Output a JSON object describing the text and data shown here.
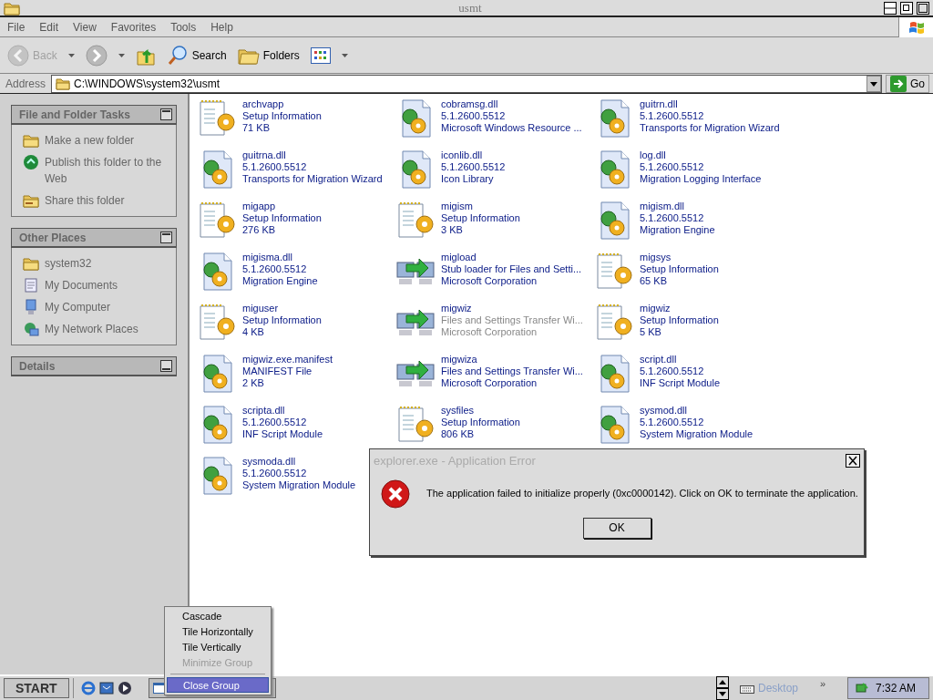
{
  "window": {
    "title": "usmt"
  },
  "menu": [
    "File",
    "Edit",
    "View",
    "Favorites",
    "Tools",
    "Help"
  ],
  "toolbar": [
    {
      "kind": "back",
      "label": "Back",
      "disabled": true
    },
    {
      "kind": "forward",
      "disabled": false
    },
    {
      "kind": "up",
      "disabled": false
    },
    {
      "kind": "search",
      "label": "Search",
      "disabled": false
    },
    {
      "kind": "folders",
      "label": "Folders",
      "disabled": false
    },
    {
      "kind": "views",
      "disabled": false
    }
  ],
  "address": {
    "label": "Address",
    "value": "C:\\WINDOWS\\system32\\usmt",
    "go": "Go"
  },
  "sidebar": [
    {
      "title": "File and Folder Tasks",
      "expanded": true,
      "items": [
        {
          "kind": "newfolder",
          "label": "Make a new folder"
        },
        {
          "kind": "web",
          "label": "Publish this folder to the Web"
        },
        {
          "kind": "share",
          "label": "Share this folder"
        }
      ]
    },
    {
      "title": "Other Places",
      "expanded": true,
      "items": [
        {
          "kind": "folder",
          "label": "system32"
        },
        {
          "kind": "docs",
          "label": "My Documents"
        },
        {
          "kind": "computer",
          "label": "My Computer"
        },
        {
          "kind": "network",
          "label": "My Network Places"
        }
      ]
    },
    {
      "title": "Details",
      "expanded": false
    }
  ],
  "files": [
    {
      "kind": "setup",
      "name": "archvapp",
      "line1": "Setup Information",
      "line2": "71 KB",
      "dimmed": false
    },
    {
      "kind": "dll",
      "name": "cobramsg.dll",
      "line1": "5.1.2600.5512",
      "line2": "Microsoft Windows Resource ...",
      "dimmed": false
    },
    {
      "kind": "dll",
      "name": "guitrn.dll",
      "line1": "5.1.2600.5512",
      "line2": "Transports for Migration Wizard",
      "dimmed": false
    },
    {
      "kind": "dll",
      "name": "guitrna.dll",
      "line1": "5.1.2600.5512",
      "line2": "Transports for Migration Wizard",
      "dimmed": false
    },
    {
      "kind": "dll",
      "name": "iconlib.dll",
      "line1": "5.1.2600.5512",
      "line2": "Icon Library",
      "dimmed": false
    },
    {
      "kind": "dll",
      "name": "log.dll",
      "line1": "5.1.2600.5512",
      "line2": "Migration Logging Interface",
      "dimmed": false
    },
    {
      "kind": "setup",
      "name": "migapp",
      "line1": "Setup Information",
      "line2": "276 KB",
      "dimmed": false
    },
    {
      "kind": "setup",
      "name": "migism",
      "line1": "Setup Information",
      "line2": "3 KB",
      "dimmed": false
    },
    {
      "kind": "dll",
      "name": "migism.dll",
      "line1": "5.1.2600.5512",
      "line2": "Migration Engine",
      "dimmed": false
    },
    {
      "kind": "dll",
      "name": "migisma.dll",
      "line1": "5.1.2600.5512",
      "line2": "Migration Engine",
      "dimmed": false
    },
    {
      "kind": "exe",
      "name": "migload",
      "line1": "Stub loader for Files and Setti...",
      "line2": "Microsoft Corporation",
      "dimmed": false
    },
    {
      "kind": "setup",
      "name": "migsys",
      "line1": "Setup Information",
      "line2": "65 KB",
      "dimmed": false
    },
    {
      "kind": "setup",
      "name": "miguser",
      "line1": "Setup Information",
      "line2": "4 KB",
      "dimmed": false
    },
    {
      "kind": "exe",
      "name": "migwiz",
      "line1": "Files and Settings Transfer Wi...",
      "line2": "Microsoft Corporation",
      "dimmed": true
    },
    {
      "kind": "setup",
      "name": "migwiz",
      "line1": "Setup Information",
      "line2": "5 KB",
      "dimmed": false
    },
    {
      "kind": "dll",
      "name": "migwiz.exe.manifest",
      "line1": "MANIFEST File",
      "line2": "2 KB",
      "dimmed": false
    },
    {
      "kind": "exe",
      "name": "migwiza",
      "line1": "Files and Settings Transfer Wi...",
      "line2": "Microsoft Corporation",
      "dimmed": false
    },
    {
      "kind": "dll",
      "name": "script.dll",
      "line1": "5.1.2600.5512",
      "line2": "INF Script Module",
      "dimmed": false
    },
    {
      "kind": "dll",
      "name": "scripta.dll",
      "line1": "5.1.2600.5512",
      "line2": "INF Script Module",
      "dimmed": false
    },
    {
      "kind": "setup",
      "name": "sysfiles",
      "line1": "Setup Information",
      "line2": "806 KB",
      "dimmed": false
    },
    {
      "kind": "dll",
      "name": "sysmod.dll",
      "line1": "5.1.2600.5512",
      "line2": "System Migration Module",
      "dimmed": false
    },
    {
      "kind": "dll",
      "name": "sysmoda.dll",
      "line1": "5.1.2600.5512",
      "line2": "System Migration Module",
      "dimmed": false
    }
  ],
  "dialog": {
    "title": "explorer.exe - Application Error",
    "message": "The application failed to initialize properly (0xc0000142). Click on OK to terminate the application.",
    "button": "OK"
  },
  "context_menu": [
    {
      "label": "Cascade",
      "disabled": false,
      "selected": false
    },
    {
      "label": "Tile Horizontally",
      "disabled": false,
      "selected": false
    },
    {
      "label": "Tile Vertically",
      "disabled": false,
      "selected": false
    },
    {
      "label": "Minimize Group",
      "disabled": true,
      "selected": false
    },
    {
      "label": "Close Group",
      "disabled": false,
      "selected": true
    }
  ],
  "taskbar": {
    "start": "START",
    "quick_launch": [
      {
        "kind": "ie"
      },
      {
        "kind": "outlook"
      },
      {
        "kind": "media"
      }
    ],
    "desktop_toolbar": "Desktop",
    "chevron": "»",
    "clock": "7:32 AM"
  }
}
